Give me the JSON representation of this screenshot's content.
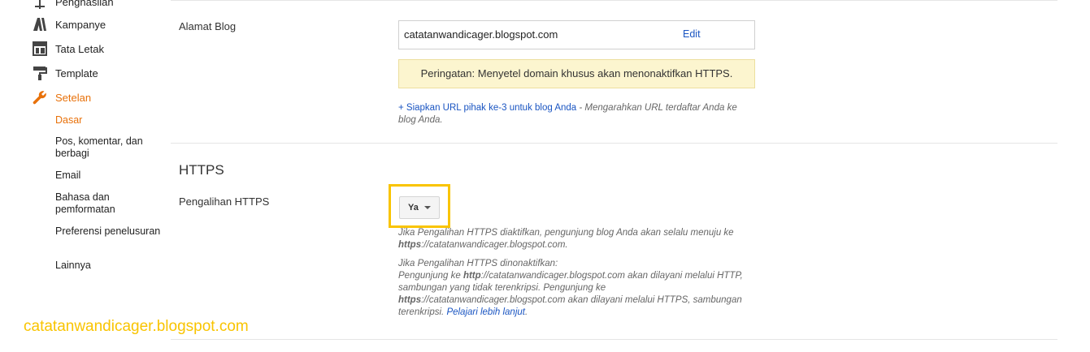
{
  "sidebar": {
    "items": [
      {
        "label": "Penghasilan",
        "icon": "dollar-icon"
      },
      {
        "label": "Kampanye",
        "icon": "campaign-icon"
      },
      {
        "label": "Tata Letak",
        "icon": "layout-icon"
      },
      {
        "label": "Template",
        "icon": "paint-roller-icon"
      },
      {
        "label": "Setelan",
        "icon": "wrench-icon"
      }
    ],
    "subitems": [
      "Dasar",
      "Pos, komentar, dan berbagi",
      "Email",
      "Bahasa dan pemformatan",
      "Preferensi penelusuran",
      "Lainnya"
    ]
  },
  "blog_address": {
    "label": "Alamat Blog",
    "url": "catatanwandicager.blogspot.com",
    "edit_label": "Edit",
    "warning": "Peringatan: Menyetel domain khusus akan menonaktifkan HTTPS.",
    "setup_link": "+ Siapkan URL pihak ke-3 untuk blog Anda",
    "setup_desc": " - Mengarahkan URL terdaftar Anda ke blog Anda."
  },
  "https": {
    "section_title": "HTTPS",
    "redirect_label": "Pengalihan HTTPS",
    "redirect_value": "Ya",
    "enabled_text_1": "Jika Pengalihan HTTPS diaktifkan, pengunjung blog Anda akan selalu menuju ke ",
    "enabled_bold": "https",
    "enabled_text_2": "://catatanwandicager.blogspot.com.",
    "disabled_intro": "Jika Pengalihan HTTPS dinonaktifkan:",
    "disabled_text_1": "Pengunjung ke ",
    "disabled_bold_1": "http",
    "disabled_text_2": "://catatanwandicager.blogspot.com akan dilayani melalui HTTP, sambungan yang tidak terenkripsi. Pengunjung ke ",
    "disabled_bold_2": "https",
    "disabled_text_3": "://catatanwandicager.blogspot.com akan dilayani melalui HTTPS, sambungan terenkripsi. ",
    "learn_more": "Pelajari lebih lanjut",
    "learn_more_end": "."
  },
  "watermark": "catatanwandicager.blogspot.com",
  "colors": {
    "accent": "#e8710a",
    "link": "#1a55c2",
    "highlight": "#f9c400",
    "warning_bg": "#fcf5cf"
  }
}
